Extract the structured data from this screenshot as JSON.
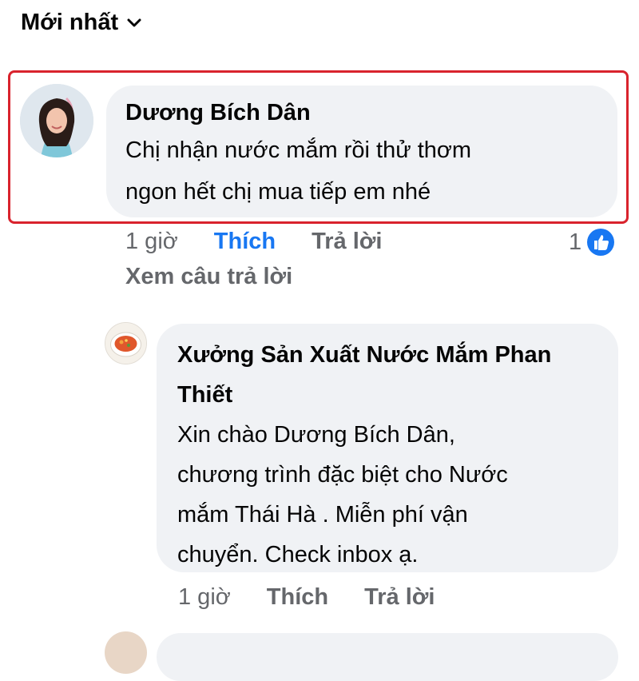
{
  "sort": {
    "label": "Mới nhất"
  },
  "comments": [
    {
      "author": "Dương Bích Dân",
      "text_lines": [
        "Chị nhận nước mắm rồi thử thơm",
        "ngon hết chị mua tiếp em nhé"
      ],
      "time": "1 giờ",
      "like_label": "Thích",
      "reply_label": "Trả lời",
      "reaction_count": "1",
      "view_replies": "Xem câu trả lời"
    },
    {
      "author_lines": [
        "Xưởng Sản Xuất Nước Mắm Phan",
        "Thiết"
      ],
      "text_lines": [
        "Xin chào Dương Bích Dân,",
        "chương trình đặc biệt cho Nước",
        "mắm Thái Hà . Miễn phí vận",
        "chuyển. Check inbox ạ."
      ],
      "time": "1 giờ",
      "like_label": "Thích",
      "reply_label": "Trả lời"
    }
  ],
  "colors": {
    "highlight": "#d9232d",
    "bubble": "#f0f2f5",
    "like_active": "#1877f2",
    "muted": "#65676b"
  }
}
